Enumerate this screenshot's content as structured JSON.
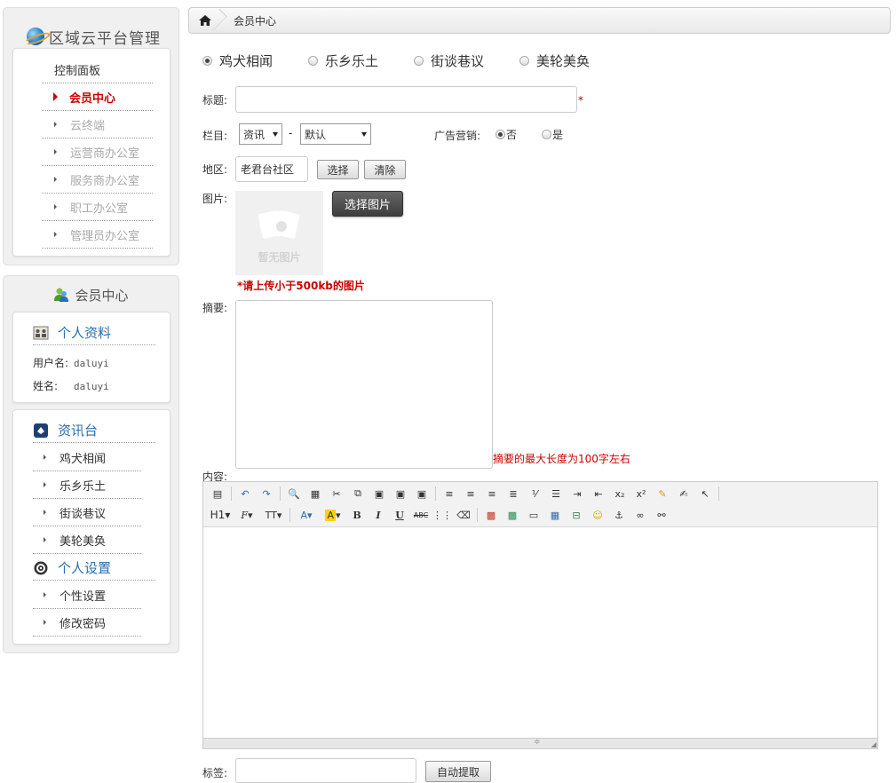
{
  "brand": {
    "title": "区域云平台管理"
  },
  "sidebar": {
    "dashboard": "控制面板",
    "items": [
      {
        "label": "会员中心",
        "active": true
      },
      {
        "label": "云终端"
      },
      {
        "label": "运营商办公室"
      },
      {
        "label": "服务商办公室"
      },
      {
        "label": "职工办公室"
      },
      {
        "label": "管理员办公室"
      }
    ]
  },
  "member": {
    "title": "会员中心",
    "profile": {
      "title": "个人资料",
      "username_label": "用户名:",
      "username": "daluyi",
      "name_label": "姓名:",
      "name": "daluyi"
    },
    "news": {
      "title": "资讯台",
      "items": [
        "鸡犬相闻",
        "乐乡乐土",
        "街谈巷议",
        "美轮美奂"
      ]
    },
    "settings": {
      "title": "个人设置",
      "items": [
        "个性设置",
        "修改密码"
      ]
    }
  },
  "breadcrumb": {
    "current": "会员中心"
  },
  "form": {
    "tabs": [
      {
        "label": "鸡犬相闻",
        "checked": true
      },
      {
        "label": "乐乡乐土"
      },
      {
        "label": "街谈巷议"
      },
      {
        "label": "美轮美奂"
      }
    ],
    "title_label": "标题:",
    "title_value": "",
    "required_mark": "*",
    "column_label": "栏目:",
    "column_select": "资讯",
    "column_dash": "-",
    "sub_select": "默认",
    "ad_label": "广告营销:",
    "ad_no": "否",
    "ad_yes": "是",
    "region_label": "地区:",
    "region_value": "老君台社区",
    "select_btn": "选择",
    "clear_btn": "清除",
    "image_label": "图片:",
    "no_image": "暂无图片",
    "choose_image_btn": "选择图片",
    "image_hint": "*请上传小于500kb的图片",
    "summary_label": "摘要:",
    "summary_hint": "摘要的最大长度为100字左右",
    "content_label": "内容:",
    "tags_label": "标签:",
    "auto_extract_btn": "自动提取"
  },
  "editor": {
    "heading": "H1",
    "font_family": "F",
    "font_size": "TT"
  },
  "colors": {
    "accent_red": "#cc0000",
    "link_blue": "#2a6fb0"
  }
}
